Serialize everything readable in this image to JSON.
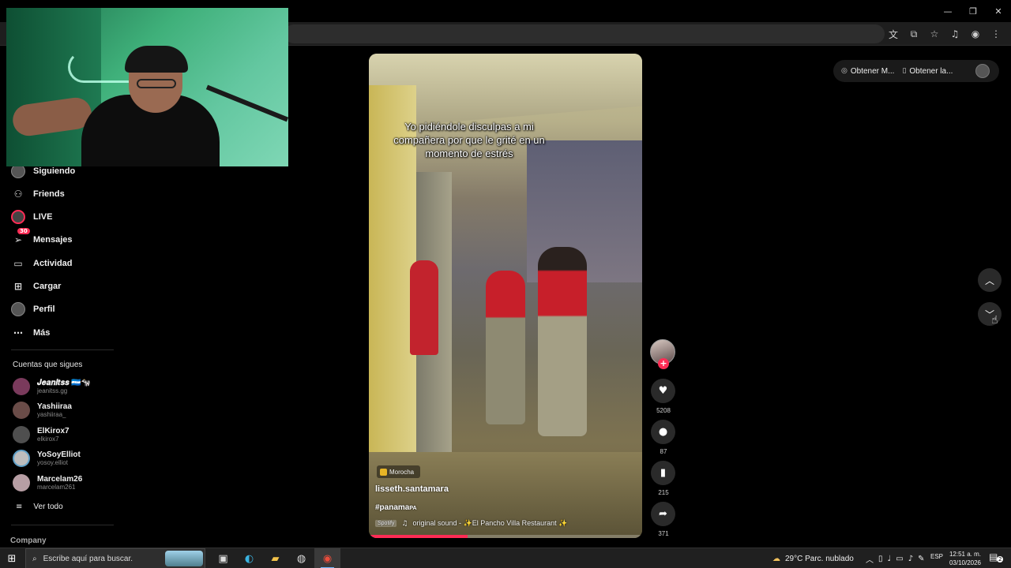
{
  "browser": {
    "window_controls": {
      "minimize": "—",
      "restore": "❐",
      "close": "✕"
    },
    "toolbar_icons": [
      "translate-icon",
      "cast-icon",
      "bookmark-star-icon",
      "media-icon",
      "profile-icon",
      "menu-icon"
    ]
  },
  "sidebar": {
    "items": [
      {
        "label": "Siguiendo",
        "icon": "following-avatar-icon"
      },
      {
        "label": "Friends",
        "icon": "friends-icon"
      },
      {
        "label": "LIVE",
        "icon": "live-icon"
      },
      {
        "label": "Mensajes",
        "icon": "messages-icon",
        "badge": "30"
      },
      {
        "label": "Actividad",
        "icon": "activity-icon"
      },
      {
        "label": "Cargar",
        "icon": "upload-icon"
      },
      {
        "label": "Perfil",
        "icon": "profile-avatar-icon"
      },
      {
        "label": "Más",
        "icon": "more-icon"
      }
    ],
    "following_title": "Cuentas que sigues",
    "following": [
      {
        "name": "𝑱𝒆𝒂𝒏𝒊𝒕𝒔𝒔 🇭🇳🐄",
        "handle": "jeanitss.gg"
      },
      {
        "name": "Yashiiraa",
        "handle": "yashiiraa_"
      },
      {
        "name": "ElKirox7",
        "handle": "elkirox7"
      },
      {
        "name": "YoSoyElliot",
        "handle": "yosoy.elliot"
      },
      {
        "name": "Marcelam26",
        "handle": "marcelam261"
      }
    ],
    "see_all": "Ver todo",
    "company": "Company"
  },
  "video": {
    "caption": "Yo pidiéndole disculpas a mi compañera por que le grité en un momento de estrés",
    "tag": "Morocha",
    "username": "lisseth.santamara",
    "hashtag": "#panama",
    "hashtag_suffix": "PA",
    "spotify": "Spotify",
    "sound": "original sound - ✨El Pancho Villa Restaurant ✨",
    "progress": 0.36
  },
  "actions": {
    "likes": "5208",
    "comments": "87",
    "saves": "215",
    "shares": "371"
  },
  "top_right": {
    "pill1": "Obtener M...",
    "pill2": "Obtener la..."
  },
  "taskbar": {
    "search_placeholder": "Escribe aquí para buscar.",
    "weather": "29°C  Parc. nublado",
    "lang": "ESP",
    "time": "12:51 a. m.",
    "date": "03/10/2026",
    "notifications": "2"
  }
}
